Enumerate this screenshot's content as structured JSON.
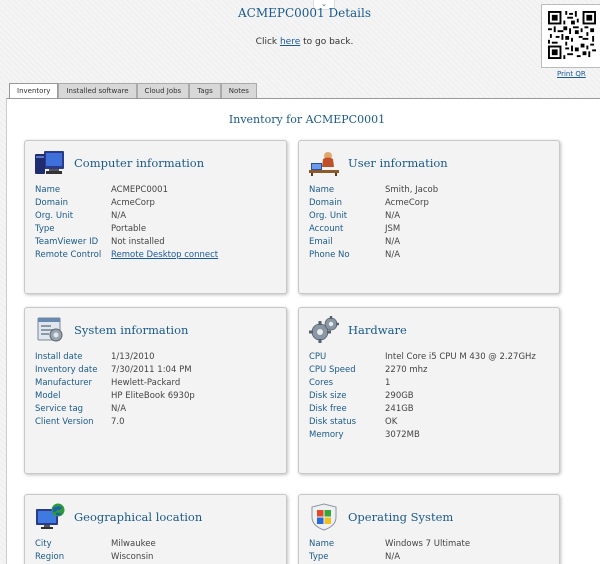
{
  "header": {
    "title": "ACMEPC0001 Details",
    "back_prefix": "Click ",
    "back_link": "here",
    "back_suffix": " to go back.",
    "print_qr": "Print QR"
  },
  "tabs": [
    {
      "label": "Inventory",
      "active": true
    },
    {
      "label": "Installed software"
    },
    {
      "label": "Cloud Jobs"
    },
    {
      "label": "Tags"
    },
    {
      "label": "Notes"
    }
  ],
  "inventory_title": "Inventory for ACMEPC0001",
  "cards": {
    "computer": {
      "title": "Computer information",
      "icon": "monitor-icon",
      "rows": [
        {
          "k": "Name",
          "v": "ACMEPC0001"
        },
        {
          "k": "Domain",
          "v": "AcmeCorp"
        },
        {
          "k": "Org. Unit",
          "v": "N/A"
        },
        {
          "k": "Type",
          "v": "Portable"
        },
        {
          "k": "TeamViewer ID",
          "v": "Not installed"
        },
        {
          "k": "Remote Control",
          "v": "Remote Desktop connect"
        }
      ]
    },
    "user": {
      "title": "User information",
      "icon": "user-at-desk-icon",
      "rows": [
        {
          "k": "Name",
          "v": "Smith, Jacob"
        },
        {
          "k": "Domain",
          "v": "AcmeCorp"
        },
        {
          "k": "Org. Unit",
          "v": "N/A"
        },
        {
          "k": "Account",
          "v": "JSM"
        },
        {
          "k": "Email",
          "v": "N/A"
        },
        {
          "k": "Phone No",
          "v": "N/A"
        }
      ]
    },
    "system": {
      "title": "System information",
      "icon": "system-window-icon",
      "rows": [
        {
          "k": "Install date",
          "v": "1/13/2010"
        },
        {
          "k": "Inventory date",
          "v": "7/30/2011 1:04 PM"
        },
        {
          "k": "Manufacturer",
          "v": "Hewlett-Packard"
        },
        {
          "k": "Model",
          "v": "HP EliteBook 6930p"
        },
        {
          "k": "Service tag",
          "v": "N/A"
        },
        {
          "k": "Client Version",
          "v": "7.0"
        }
      ]
    },
    "hardware": {
      "title": "Hardware",
      "icon": "gears-icon",
      "rows": [
        {
          "k": "CPU",
          "v": "Intel Core i5 CPU M 430 @ 2.27GHz"
        },
        {
          "k": "CPU Speed",
          "v": "2270 mhz"
        },
        {
          "k": "Cores",
          "v": "1"
        },
        {
          "k": "Disk size",
          "v": "290GB"
        },
        {
          "k": "Disk free",
          "v": "241GB"
        },
        {
          "k": "Disk status",
          "v": "OK"
        },
        {
          "k": "Memory",
          "v": "3072MB"
        }
      ]
    },
    "geo": {
      "title": "Geographical location",
      "icon": "globe-monitor-icon",
      "rows": [
        {
          "k": "City",
          "v": "Milwaukee"
        },
        {
          "k": "Region",
          "v": "Wisconsin"
        }
      ]
    },
    "os": {
      "title": "Operating System",
      "icon": "windows-shield-icon",
      "rows": [
        {
          "k": "Name",
          "v": "Windows 7 Ultimate"
        },
        {
          "k": "Type",
          "v": "N/A"
        }
      ]
    }
  }
}
